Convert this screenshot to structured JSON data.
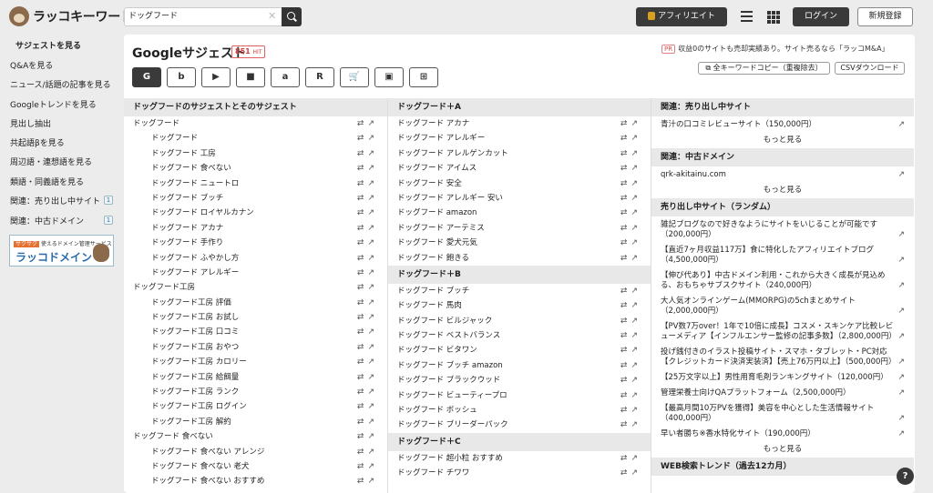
{
  "header": {
    "logo": "ラッコキーワード",
    "search_value": "ドッグフード",
    "affiliate": "アフィリエイト",
    "login": "ログイン",
    "signup": "新規登録"
  },
  "sidebar": {
    "items": [
      {
        "label": "サジェストを見る"
      },
      {
        "label": "Q&Aを見る"
      },
      {
        "label": "ニュース/話題の記事を見る"
      },
      {
        "label": "Googleトレンドを見る"
      },
      {
        "label": "見出し抽出"
      },
      {
        "label": "共起語βを見る"
      },
      {
        "label": "周辺語・連想語を見る"
      },
      {
        "label": "類語・同義語を見る"
      },
      {
        "label": "関連：売り出し中サイト",
        "badge": "1"
      },
      {
        "label": "関連：中古ドメイン",
        "badge": "1"
      }
    ],
    "banner_top": "サクサク",
    "banner_sub": "使えるドメイン管理サービス",
    "banner_main": "ラッコドメイン"
  },
  "main": {
    "title": "Googleサジェスト",
    "hits": "851",
    "hits_unit": "HIT",
    "pr_tag": "PR",
    "pr_text": "収益0のサイトも売却実績あり。サイト売るなら「ラッコM&A」",
    "copy_btn": "全キーワードコピー（重複除去）",
    "csv_btn": "CSVダウンロード",
    "engines": [
      "G",
      "b",
      "▶",
      "■",
      "a",
      "R",
      "🛒",
      "▣",
      "⊞"
    ]
  },
  "col1": {
    "header": "ドッグフードのサジェストとそのサジェスト",
    "rows": [
      {
        "t": "ドッグフード",
        "top": true
      },
      {
        "t": "ドッグフード"
      },
      {
        "t": "ドッグフード 工房"
      },
      {
        "t": "ドッグフード 食べない"
      },
      {
        "t": "ドッグフード ニュートロ"
      },
      {
        "t": "ドッグフード ブッチ"
      },
      {
        "t": "ドッグフード ロイヤルカナン"
      },
      {
        "t": "ドッグフード アカナ"
      },
      {
        "t": "ドッグフード 手作り"
      },
      {
        "t": "ドッグフード ふやかし方"
      },
      {
        "t": "ドッグフード アレルギー"
      },
      {
        "t": "ドッグフード工房",
        "top": true
      },
      {
        "t": "ドッグフード工房 評価"
      },
      {
        "t": "ドッグフード工房 お試し"
      },
      {
        "t": "ドッグフード工房 口コミ"
      },
      {
        "t": "ドッグフード工房 おやつ"
      },
      {
        "t": "ドッグフード工房 カロリー"
      },
      {
        "t": "ドッグフード工房 給餌量"
      },
      {
        "t": "ドッグフード工房 ランク"
      },
      {
        "t": "ドッグフード工房 ログイン"
      },
      {
        "t": "ドッグフード工房 解約"
      },
      {
        "t": "ドッグフード 食べない",
        "top": true
      },
      {
        "t": "ドッグフード 食べない アレンジ"
      },
      {
        "t": "ドッグフード 食べない 老犬"
      },
      {
        "t": "ドッグフード 食べない おすすめ"
      }
    ]
  },
  "col2": {
    "groups": [
      {
        "header": "ドッグフード＋A",
        "rows": [
          "ドッグフード アカナ",
          "ドッグフード アレルギー",
          "ドッグフード アレルゲンカット",
          "ドッグフード アイムス",
          "ドッグフード 安全",
          "ドッグフード アレルギー 安い",
          "ドッグフード amazon",
          "ドッグフード アーテミス",
          "ドッグフード 愛犬元気",
          "ドッグフード 飽きる"
        ]
      },
      {
        "header": "ドッグフード＋B",
        "rows": [
          "ドッグフード ブッチ",
          "ドッグフード 馬肉",
          "ドッグフード ビルジャック",
          "ドッグフード ベストバランス",
          "ドッグフード ビタワン",
          "ドッグフード ブッチ amazon",
          "ドッグフード ブラックウッド",
          "ドッグフード ビューティープロ",
          "ドッグフード ボッシュ",
          "ドッグフード ブリーダーパック"
        ]
      },
      {
        "header": "ドッグフード＋C",
        "rows": [
          "ドッグフード 超小粒 おすすめ",
          "ドッグフード チワワ"
        ]
      }
    ]
  },
  "col3": {
    "s1": {
      "header": "関連：売り出し中サイト",
      "items": [
        "青汁の口コミレビューサイト（150,000円）"
      ],
      "more": "もっと見る"
    },
    "s2": {
      "header": "関連：中古ドメイン",
      "items": [
        "qrk-akitainu.com"
      ],
      "more": "もっと見る"
    },
    "s3": {
      "header": "売り出し中サイト（ランダム）",
      "items": [
        "雑記ブログなので好きなようにサイトをいじることが可能です（200,000円）",
        "【直近7ヶ月収益117万】食に特化したアフィリエイトブログ（4,500,000円）",
        "【伸び代あり】中古ドメイン利用・これから大きく成長が見込める、おもちゃサブスクサイト（240,000円）",
        "大人気オンラインゲーム(MMORPG)の5chまとめサイト（2,000,000円）",
        "【PV数7万over！1年で10倍に成長】コスメ・スキンケア比較レビューメディア【インフルエンサー監修の記事多数】（2,800,000円）",
        "投げ銭付きのイラスト投稿サイト・スマホ・タブレット・PC対応【クレジットカード決済実装済】【売上76万円以上】（500,000円）",
        "【25万文字以上】男性用育毛剤ランキングサイト（120,000円）",
        "管理栄養士向けQAプラットフォーム（2,500,000円）",
        "【最高月間10万PVを獲得】美容を中心とした生活情報サイト（400,000円）",
        "早い者勝ち※香水特化サイト（190,000円）"
      ],
      "more": "もっと見る"
    },
    "s4": {
      "header": "WEB検索トレンド（過去12カ月）"
    }
  },
  "help": "?"
}
